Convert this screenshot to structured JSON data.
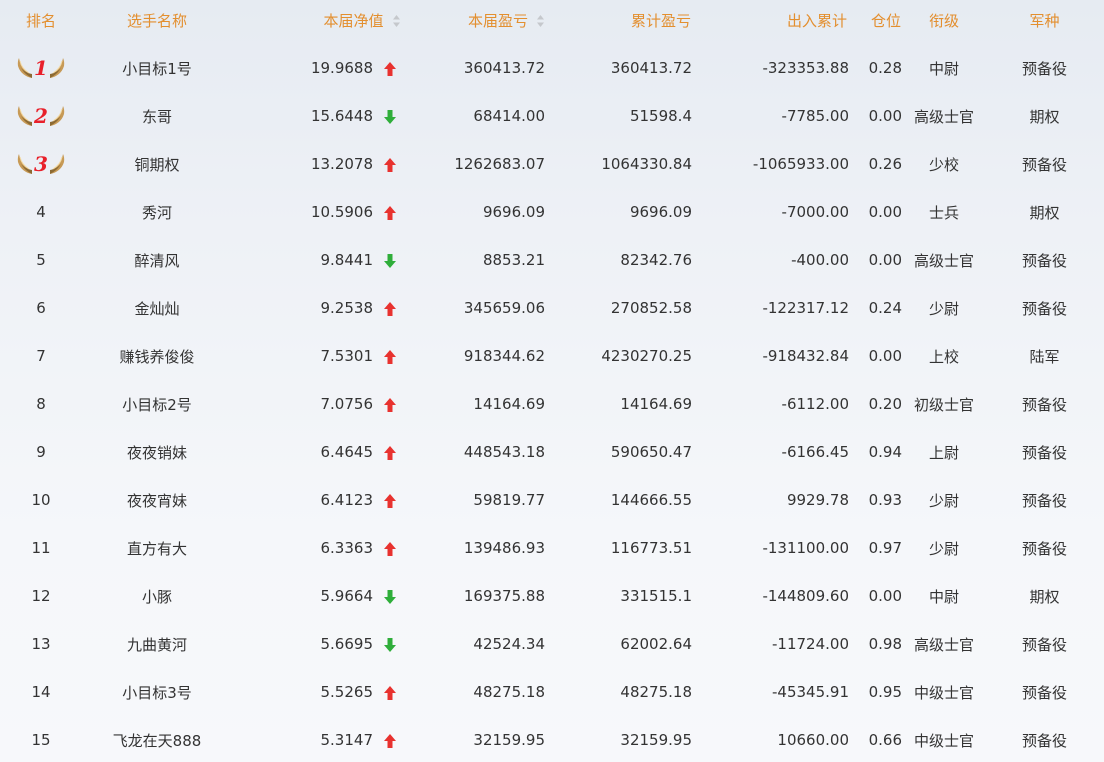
{
  "header": {
    "rank": "排名",
    "name": "选手名称",
    "net_value": "本届净值",
    "session_pnl": "本届盈亏",
    "cumulative_pnl": "累计盈亏",
    "cash_flow": "出入累计",
    "position": "仓位",
    "title": "衔级",
    "arm": "军种"
  },
  "colors": {
    "header_text": "#e38f2f",
    "up_arrow": "#e8322f",
    "down_arrow": "#2fae3a",
    "medal_number": "#e8202a"
  },
  "rows": [
    {
      "rank": "1",
      "medal": true,
      "name": "小目标1号",
      "net_value": "19.9688",
      "trend": "up",
      "session_pnl": "360413.72",
      "cumulative_pnl": "360413.72",
      "cash_flow": "-323353.88",
      "position": "0.28",
      "title": "中尉",
      "arm": "预备役"
    },
    {
      "rank": "2",
      "medal": true,
      "name": "东哥",
      "net_value": "15.6448",
      "trend": "down",
      "session_pnl": "68414.00",
      "cumulative_pnl": "51598.4",
      "cash_flow": "-7785.00",
      "position": "0.00",
      "title": "高级士官",
      "arm": "期权"
    },
    {
      "rank": "3",
      "medal": true,
      "name": "铜期权",
      "net_value": "13.2078",
      "trend": "up",
      "session_pnl": "1262683.07",
      "cumulative_pnl": "1064330.84",
      "cash_flow": "-1065933.00",
      "position": "0.26",
      "title": "少校",
      "arm": "预备役"
    },
    {
      "rank": "4",
      "medal": false,
      "name": "秀河",
      "net_value": "10.5906",
      "trend": "up",
      "session_pnl": "9696.09",
      "cumulative_pnl": "9696.09",
      "cash_flow": "-7000.00",
      "position": "0.00",
      "title": "士兵",
      "arm": "期权"
    },
    {
      "rank": "5",
      "medal": false,
      "name": "醉清风",
      "net_value": "9.8441",
      "trend": "down",
      "session_pnl": "8853.21",
      "cumulative_pnl": "82342.76",
      "cash_flow": "-400.00",
      "position": "0.00",
      "title": "高级士官",
      "arm": "预备役"
    },
    {
      "rank": "6",
      "medal": false,
      "name": "金灿灿",
      "net_value": "9.2538",
      "trend": "up",
      "session_pnl": "345659.06",
      "cumulative_pnl": "270852.58",
      "cash_flow": "-122317.12",
      "position": "0.24",
      "title": "少尉",
      "arm": "预备役"
    },
    {
      "rank": "7",
      "medal": false,
      "name": "赚钱养俊俊",
      "net_value": "7.5301",
      "trend": "up",
      "session_pnl": "918344.62",
      "cumulative_pnl": "4230270.25",
      "cash_flow": "-918432.84",
      "position": "0.00",
      "title": "上校",
      "arm": "陆军"
    },
    {
      "rank": "8",
      "medal": false,
      "name": "小目标2号",
      "net_value": "7.0756",
      "trend": "up",
      "session_pnl": "14164.69",
      "cumulative_pnl": "14164.69",
      "cash_flow": "-6112.00",
      "position": "0.20",
      "title": "初级士官",
      "arm": "预备役"
    },
    {
      "rank": "9",
      "medal": false,
      "name": "夜夜销妹",
      "net_value": "6.4645",
      "trend": "up",
      "session_pnl": "448543.18",
      "cumulative_pnl": "590650.47",
      "cash_flow": "-6166.45",
      "position": "0.94",
      "title": "上尉",
      "arm": "预备役"
    },
    {
      "rank": "10",
      "medal": false,
      "name": "夜夜宵妹",
      "net_value": "6.4123",
      "trend": "up",
      "session_pnl": "59819.77",
      "cumulative_pnl": "144666.55",
      "cash_flow": "9929.78",
      "position": "0.93",
      "title": "少尉",
      "arm": "预备役"
    },
    {
      "rank": "11",
      "medal": false,
      "name": "直方有大",
      "net_value": "6.3363",
      "trend": "up",
      "session_pnl": "139486.93",
      "cumulative_pnl": "116773.51",
      "cash_flow": "-131100.00",
      "position": "0.97",
      "title": "少尉",
      "arm": "预备役"
    },
    {
      "rank": "12",
      "medal": false,
      "name": "小豚",
      "net_value": "5.9664",
      "trend": "down",
      "session_pnl": "169375.88",
      "cumulative_pnl": "331515.1",
      "cash_flow": "-144809.60",
      "position": "0.00",
      "title": "中尉",
      "arm": "期权"
    },
    {
      "rank": "13",
      "medal": false,
      "name": "九曲黄河",
      "net_value": "5.6695",
      "trend": "down",
      "session_pnl": "42524.34",
      "cumulative_pnl": "62002.64",
      "cash_flow": "-11724.00",
      "position": "0.98",
      "title": "高级士官",
      "arm": "预备役"
    },
    {
      "rank": "14",
      "medal": false,
      "name": "小目标3号",
      "net_value": "5.5265",
      "trend": "up",
      "session_pnl": "48275.18",
      "cumulative_pnl": "48275.18",
      "cash_flow": "-45345.91",
      "position": "0.95",
      "title": "中级士官",
      "arm": "预备役"
    },
    {
      "rank": "15",
      "medal": false,
      "name": "飞龙在天888",
      "net_value": "5.3147",
      "trend": "up",
      "session_pnl": "32159.95",
      "cumulative_pnl": "32159.95",
      "cash_flow": "10660.00",
      "position": "0.66",
      "title": "中级士官",
      "arm": "预备役"
    }
  ]
}
